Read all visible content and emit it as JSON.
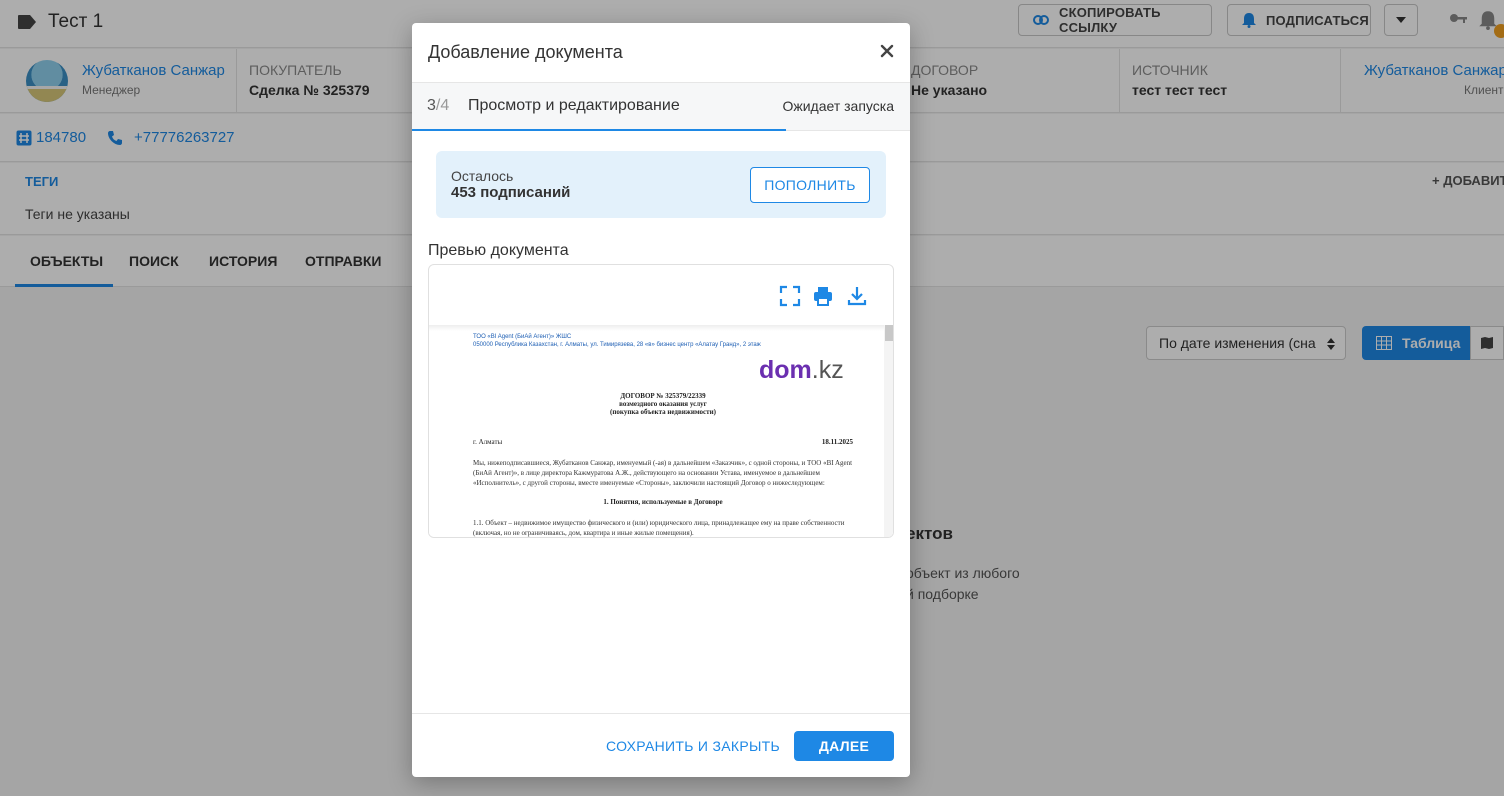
{
  "header": {
    "title": "Тест 1",
    "copy_link_label": "СКОПИРОВАТЬ ССЫЛКУ",
    "subscribe_label": "ПОДПИСАТЬСЯ"
  },
  "deal_info": {
    "manager_name": "Жубатканов Санжар",
    "manager_role": "Менеджер",
    "buyer_label": "ПОКУПАТЕЛЬ",
    "buyer_value": "Сделка № 325379",
    "contract_label": "ДОГОВОР",
    "contract_value": "Не указано",
    "source_label": "ИСТОЧНИК",
    "source_value": "тест тест тест",
    "client_name": "Жубатканов Санжар",
    "client_role": "Клиент"
  },
  "contacts": {
    "id": "184780",
    "phone": "+77776263727"
  },
  "tags": {
    "title": "ТЕГИ",
    "empty": "Теги не указаны",
    "add_label": "+ ДОБАВИТЬ"
  },
  "tabs": [
    {
      "label": "ОБЪЕКТЫ"
    },
    {
      "label": "ПОИСК"
    },
    {
      "label": "ИСТОРИЯ"
    },
    {
      "label": "ОТПРАВКИ"
    }
  ],
  "objects": {
    "sort_value": "По дате изменения (сна",
    "view_table_label": "Таблица",
    "empty_title": "ектов",
    "empty_line1": "объект из любого",
    "empty_line2": "й подборке"
  },
  "modal": {
    "title": "Добавление документа",
    "step_current": "3",
    "step_total": "/4",
    "step_name": "Просмотр и редактирование",
    "step_status": "Ожидает запуска",
    "step_progress": 0.75,
    "balance_label": "Осталось",
    "balance_value": "453 подписаний",
    "topup_label": "ПОПОЛНИТЬ",
    "preview_title": "Превью документа",
    "save_label": "СОХРАНИТЬ И ЗАКРЫТЬ",
    "next_label": "ДАЛЕЕ"
  },
  "document": {
    "company_line": "ТОО «BI Agent (БиАй Агент)» ЖШС",
    "address_line": "050000 Республика Казахстан, г. Алматы, ул. Тимирязева, 28 «в» бизнес центр «Алатау Гранд», 2 этаж",
    "logo_main": "dom",
    "logo_suffix": ".kz",
    "contract_no": "ДОГОВОР № 325379/22339",
    "contract_type": "возмездного оказания услуг",
    "contract_subject": "(покупка объекта недвижимости)",
    "city": "г. Алматы",
    "date": "18.11.2025",
    "intro": "Мы, нижеподписавшиеся, Жубатканов Санжар, именуемый (-ая) в дальнейшем «Заказчик», с одной стороны, и ТОО «BI Agent (БиАй Агент)», в лице директора Кажмуратова А.Ж., действующего на основании Устава, именуемое в дальнейшем «Исполнитель», с другой стороны, вместе именуемые «Стороны», заключили настоящий Договор о нижеследующем:",
    "section1": "1. Понятия, используемые в Договоре",
    "clause": "1.1. Объект – недвижимое имущество физического и (или) юридического лица, принадлежащее ему на праве собственности (включая, но не ограничиваясь, дом, квартира и иные жилые помещения)."
  },
  "colors": {
    "accent": "#1e88e5",
    "balance_bg": "#e3f1fb",
    "logo": "#6b2fb0"
  }
}
